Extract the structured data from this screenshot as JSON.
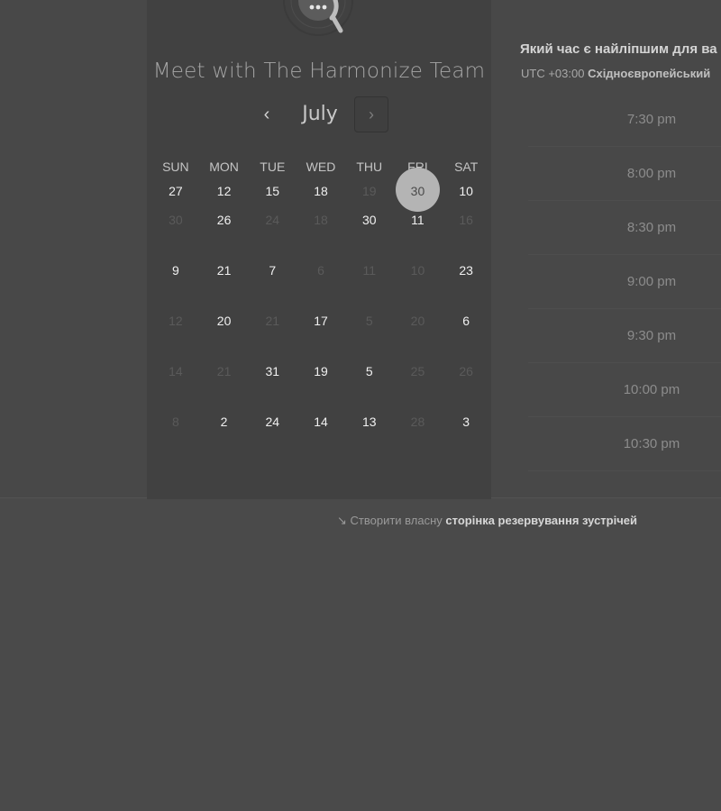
{
  "header": {
    "title": "Meet with The Harmonize Team",
    "month": "July",
    "prev_icon": "‹",
    "next_icon": "›"
  },
  "calendar": {
    "weekdays": [
      "SUN",
      "MON",
      "TUE",
      "WED",
      "THU",
      "FRI",
      "SAT"
    ],
    "weeks": [
      [
        {
          "d": "27",
          "dim": false
        },
        {
          "d": "12",
          "dim": false
        },
        {
          "d": "15",
          "dim": false
        },
        {
          "d": "18",
          "dim": false
        },
        {
          "d": "19",
          "dim": true
        },
        {
          "d": "30",
          "dim": false,
          "sel": true
        },
        {
          "d": "10",
          "dim": false
        }
      ],
      [
        {
          "d": "30",
          "dim": true
        },
        {
          "d": "26",
          "dim": false
        },
        {
          "d": "24",
          "dim": true
        },
        {
          "d": "18",
          "dim": true
        },
        {
          "d": "30",
          "dim": false
        },
        {
          "d": "11",
          "dim": false
        },
        {
          "d": "16",
          "dim": true
        }
      ],
      [
        {
          "d": "9",
          "dim": false
        },
        {
          "d": "21",
          "dim": false
        },
        {
          "d": "7",
          "dim": false
        },
        {
          "d": "6",
          "dim": true
        },
        {
          "d": "11",
          "dim": true
        },
        {
          "d": "10",
          "dim": true
        },
        {
          "d": "23",
          "dim": false
        }
      ],
      [
        {
          "d": "12",
          "dim": true
        },
        {
          "d": "20",
          "dim": false
        },
        {
          "d": "21",
          "dim": true
        },
        {
          "d": "17",
          "dim": false
        },
        {
          "d": "5",
          "dim": true
        },
        {
          "d": "20",
          "dim": true
        },
        {
          "d": "6",
          "dim": false
        }
      ],
      [
        {
          "d": "14",
          "dim": true
        },
        {
          "d": "21",
          "dim": true
        },
        {
          "d": "31",
          "dim": false
        },
        {
          "d": "19",
          "dim": false
        },
        {
          "d": "5",
          "dim": false
        },
        {
          "d": "25",
          "dim": true
        },
        {
          "d": "26",
          "dim": true
        }
      ],
      [
        {
          "d": "8",
          "dim": true
        },
        {
          "d": "2",
          "dim": false
        },
        {
          "d": "24",
          "dim": false
        },
        {
          "d": "14",
          "dim": false
        },
        {
          "d": "13",
          "dim": false
        },
        {
          "d": "28",
          "dim": true
        },
        {
          "d": "3",
          "dim": false
        }
      ]
    ]
  },
  "schedule": {
    "question": "Який час є найліпшим для ва",
    "tz_prefix": "UTC +03:00",
    "tz_name": "Східноєвропейський",
    "slots": [
      "7:30 pm",
      "8:00 pm",
      "8:30 pm",
      "9:00 pm",
      "9:30 pm",
      "10:00 pm",
      "10:30 pm"
    ]
  },
  "footer": {
    "icon": "↘",
    "text": "Створити власну",
    "link": "сторінка резервування зустрічей"
  }
}
